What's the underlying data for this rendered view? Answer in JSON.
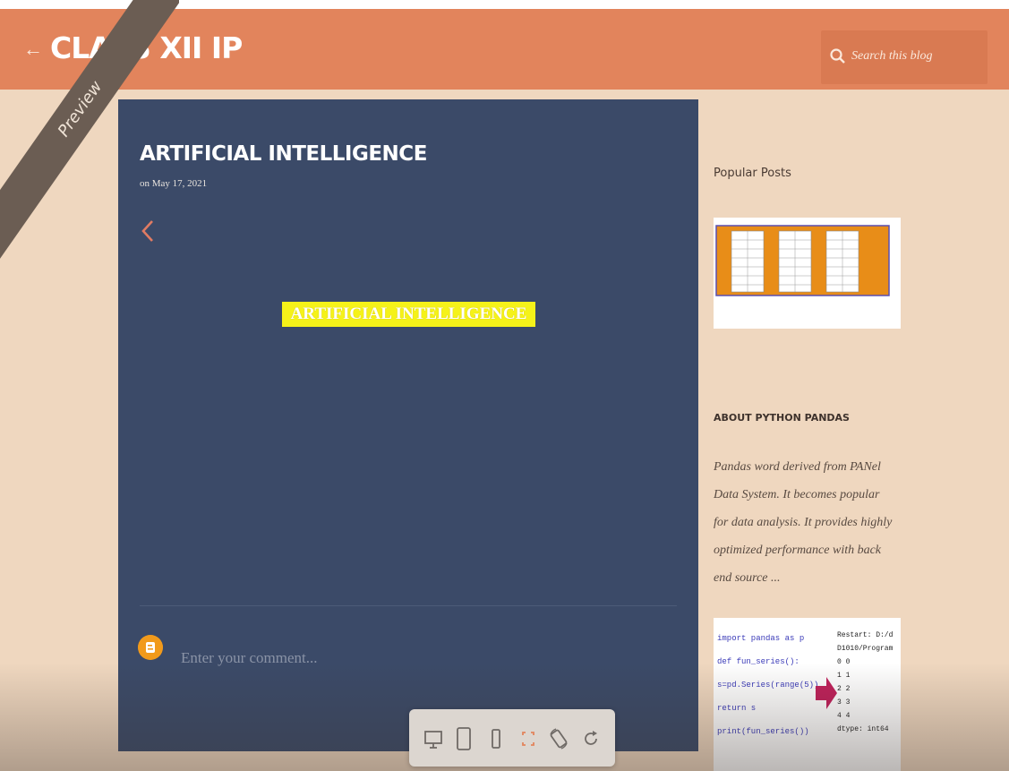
{
  "header": {
    "title": "CLASS XII IP",
    "search_placeholder": "Search this blog"
  },
  "preview_ribbon": "Preview",
  "post": {
    "title": "ARTIFICIAL INTELLIGENCE",
    "date": "on May 17, 2021",
    "highlight_text": "ARTIFICIAL INTELLIGENCE",
    "comment_placeholder": "Enter your comment..."
  },
  "sidebar": {
    "popular_heading": "Popular Posts",
    "about_heading": "ABOUT PYTHON PANDAS",
    "about_text": "Pandas word derived from PANel Data System. It becomes popular for data analysis. It provides highly optimized performance with back end source ...",
    "code_lines_left": [
      "import pandas as p",
      "def fun_series():",
      "s=pd.Series(range(5))",
      "return s",
      "print(fun_series())"
    ],
    "code_lines_right": [
      "Restart: D:/d",
      "D1010/Program",
      "0  0",
      "1  1",
      "2  2",
      "3  3",
      "4  4",
      "dtype: int64"
    ]
  },
  "toolbar": {
    "buttons": [
      "desktop-icon",
      "tablet-icon",
      "mobile-icon",
      "fullscreen-icon",
      "rotate-icon",
      "refresh-icon"
    ]
  },
  "colors": {
    "header": "#e2845c",
    "page_background": "#efd7bf",
    "post_background": "#3b4a68",
    "highlight": "#f5f219",
    "avatar": "#f19a1b"
  }
}
